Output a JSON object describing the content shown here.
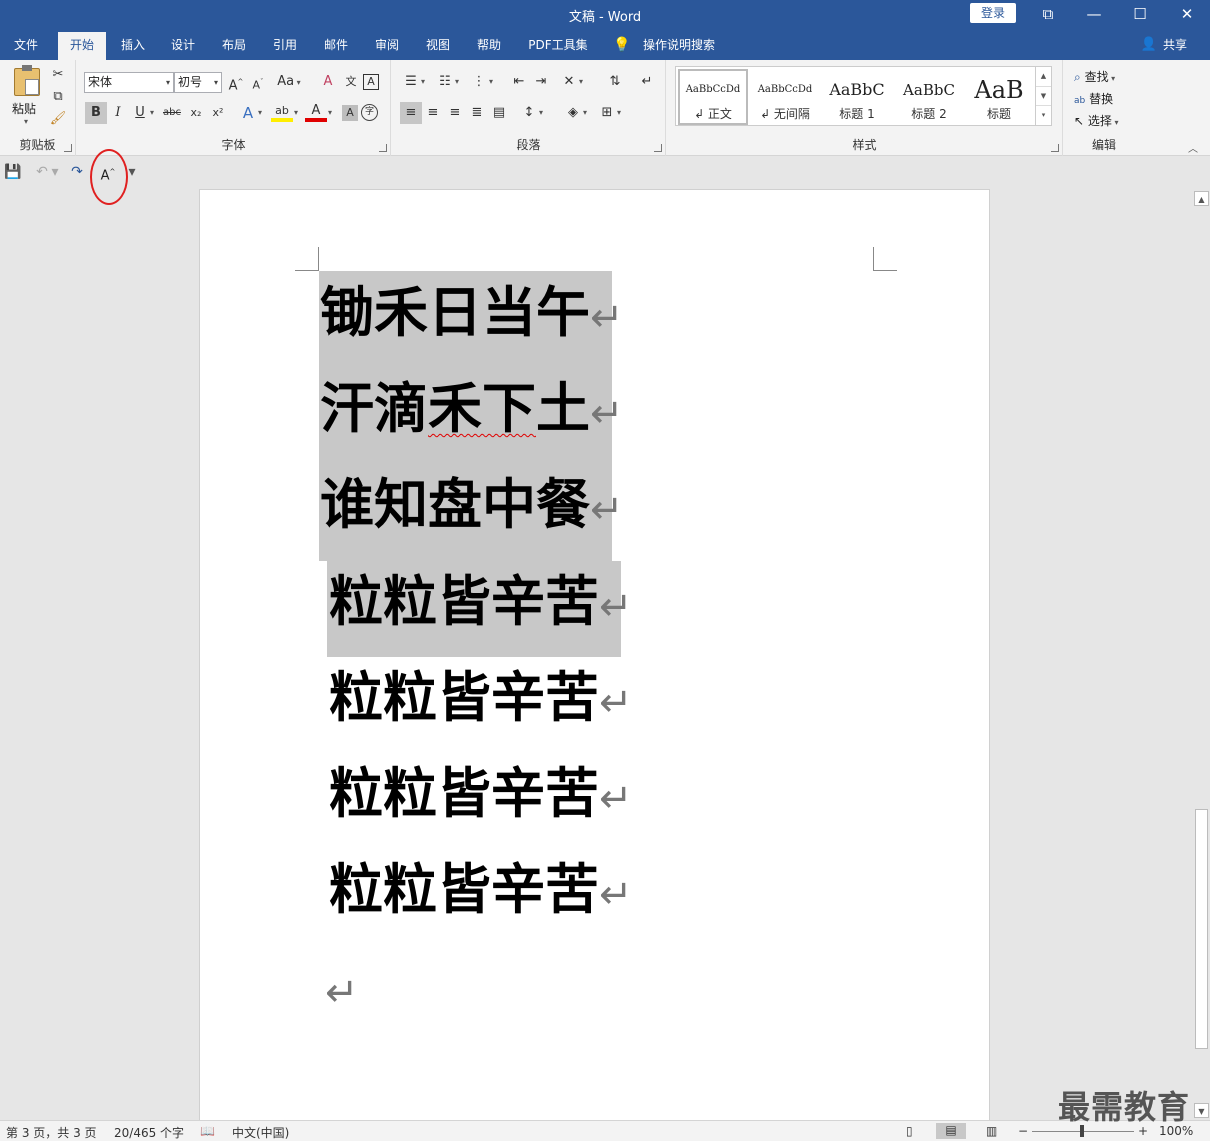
{
  "window": {
    "title": "文稿 - Word",
    "login_label": "登录",
    "buttons": [
      "⧉",
      "—",
      "☐",
      "✕"
    ]
  },
  "tabs": [
    "文件",
    "开始",
    "插入",
    "设计",
    "布局",
    "引用",
    "邮件",
    "审阅",
    "视图",
    "帮助",
    "PDF工具集",
    "操作说明搜索",
    "共享"
  ],
  "active_tab": "开始",
  "ribbon": {
    "clipboard": {
      "label": "剪贴板",
      "paste": "粘贴"
    },
    "font": {
      "label": "字体",
      "font_name": "宋体",
      "font_size": "初号",
      "bold": "B",
      "italic": "I",
      "underline": "U",
      "strike": "abc",
      "subscript": "x₂",
      "superscript": "x²",
      "grow": "A",
      "shrink": "A",
      "case": "Aa",
      "clear": "A",
      "phonetic": "文",
      "border_char": "A",
      "effects": "A",
      "highlight": "ab",
      "color": "A",
      "shading": "A",
      "enclose": "字"
    },
    "paragraph": {
      "label": "段落"
    },
    "styles": {
      "label": "样式",
      "items": [
        {
          "preview": "AaBbCcDd",
          "name": "↲ 正文"
        },
        {
          "preview": "AaBbCcDd",
          "name": "↲ 无间隔"
        },
        {
          "preview": "AaBbC",
          "name": "标题 1"
        },
        {
          "preview": "AaBbC",
          "name": "标题 2"
        },
        {
          "preview": "AaB",
          "name": "标题"
        }
      ]
    },
    "editing": {
      "label": "编辑",
      "find": "查找",
      "replace": "替换",
      "select": "选择"
    }
  },
  "qat": {
    "font_grow_icon": "A"
  },
  "document": {
    "lines": [
      "锄禾日当午",
      "汗滴禾下土",
      "谁知盘中餐",
      "粒粒皆辛苦",
      "粒粒皆辛苦",
      "粒粒皆辛苦",
      "粒粒皆辛苦"
    ],
    "line2_prefix": "汗滴",
    "line2_squiggle": "禾下",
    "line2_suffix": "土",
    "para_mark": "↵"
  },
  "status_bar": {
    "page": "第 3 页，共 3 页",
    "words": "20/465 个字",
    "language": "中文(中国)",
    "zoom": "100%"
  },
  "watermark": "最需教育"
}
